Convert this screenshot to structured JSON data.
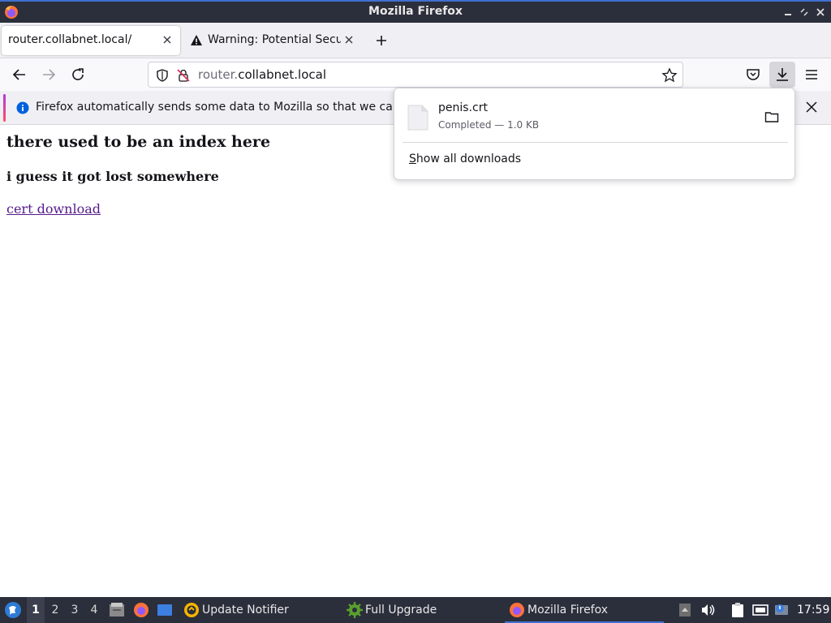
{
  "window": {
    "title": "Mozilla Firefox"
  },
  "tabs": [
    {
      "label": "router.collabnet.local/",
      "active": true
    },
    {
      "label": "Warning: Potential Security Risk Ahead",
      "active": false
    }
  ],
  "urlbar": {
    "url_prefix": "router.",
    "url_domain": "collabnet.local"
  },
  "notification": {
    "text": "Firefox automatically sends some data to Mozilla so that we can improve your experience."
  },
  "page": {
    "heading": "there used to be an index here",
    "subheading": "i guess it got lost somewhere",
    "link": "cert download"
  },
  "downloads": {
    "file_name": "penis.crt",
    "status": "Completed — 1.0 KB",
    "show_all_prefix": "S",
    "show_all_rest": "how all downloads"
  },
  "taskbar": {
    "workspaces": [
      "1",
      "2",
      "3",
      "4"
    ],
    "apps": [
      {
        "label": "Update Notifier"
      },
      {
        "label": "Full Upgrade"
      },
      {
        "label": "Mozilla Firefox"
      }
    ],
    "clock": "17:59"
  },
  "colors": {
    "accent": "#3f6fd1",
    "link_visited": "#551a8b",
    "panel_bg": "#2b2e3b"
  }
}
